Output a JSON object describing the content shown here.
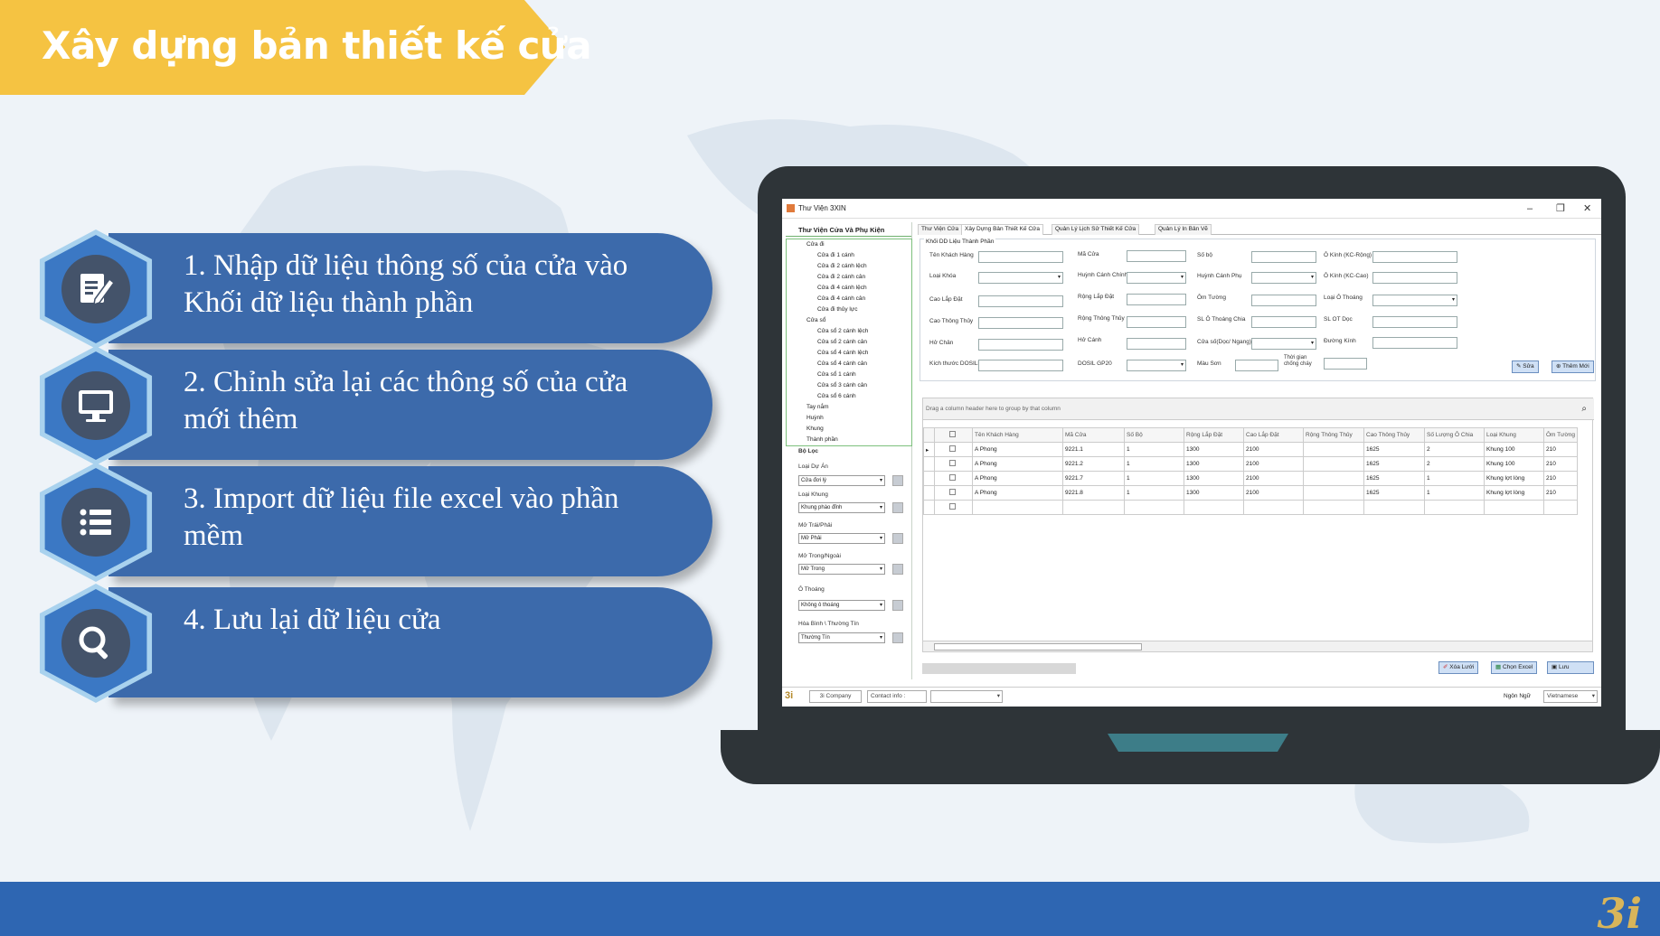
{
  "slide": {
    "title": "Xây dựng bản thiết kế cửa",
    "logo": "3i",
    "steps": [
      {
        "text": "1. Nhập dữ liệu thông số của cửa vào Khối dữ liệu thành phần",
        "icon": "edit-icon"
      },
      {
        "text": "2. Chỉnh sửa lại các thông số của cửa mới thêm",
        "icon": "monitor-icon"
      },
      {
        "text": "3. Import dữ liệu file excel vào phần mềm",
        "icon": "list-icon"
      },
      {
        "text": "4. Lưu lại dữ liệu cửa",
        "icon": "search-icon"
      }
    ]
  },
  "app": {
    "window_title": "Thư Viện 3XIN",
    "sidebar_title": "Thư Viện Cửa Và Phụ Kiện",
    "tree": [
      {
        "label": "Cửa đi",
        "level": 0
      },
      {
        "label": "Cửa đi 1 cánh",
        "level": 1
      },
      {
        "label": "Cửa đi 2 cánh lệch",
        "level": 1
      },
      {
        "label": "Cửa đi 2 cánh cân",
        "level": 1
      },
      {
        "label": "Cửa đi 4 cánh lệch",
        "level": 1
      },
      {
        "label": "Cửa đi 4 cánh cân",
        "level": 1
      },
      {
        "label": "Cửa đi thủy lực",
        "level": 1
      },
      {
        "label": "Cửa sổ",
        "level": 0
      },
      {
        "label": "Cửa sổ 2 cánh lệch",
        "level": 1
      },
      {
        "label": "Cửa sổ 2 cánh cân",
        "level": 1
      },
      {
        "label": "Cửa sổ 4 cánh lệch",
        "level": 1
      },
      {
        "label": "Cửa sổ 4 cánh cân",
        "level": 1
      },
      {
        "label": "Cửa sổ 1 cánh",
        "level": 1
      },
      {
        "label": "Cửa sổ 3 cánh cân",
        "level": 1
      },
      {
        "label": "Cửa sổ 6 cánh",
        "level": 1
      },
      {
        "label": "Tay nắm",
        "level": 0
      },
      {
        "label": "Huỳnh",
        "level": 0
      },
      {
        "label": "Khung",
        "level": 0
      },
      {
        "label": "Thành phần",
        "level": 0
      }
    ],
    "filter": {
      "title": "Bộ Lọc",
      "items": [
        {
          "label": "Loại Dự Án",
          "value": "Cửa đơi lý"
        },
        {
          "label": "Loại Khung",
          "value": "Khung phào đỉnh"
        },
        {
          "label": "Mở Trái/Phải",
          "value": "Mở Phải"
        },
        {
          "label": "Mở Trong/Ngoài",
          "value": "Mở Trong"
        },
        {
          "label": "Ô Thoáng",
          "value": "Không ô thoáng"
        },
        {
          "label": "Hòa Bình \\ Thường Tín",
          "value": "Thường Tín"
        }
      ]
    },
    "tabs": [
      "Thư Viện Cửa",
      "Xây Dựng Bản Thiết Kế Cửa",
      "Quản Lý Lịch Sử Thiết Kế Cửa",
      "Quản Lý In Bản Vẽ"
    ],
    "panel_title": "Khối DD Liệu Thành Phần",
    "fields": {
      "col1": [
        "Tên Khách Hàng",
        "Loại Khóa",
        "Cao Lắp Đặt",
        "Cao Thông Thủy",
        "Hở Chân",
        "Kích thước DOSILL"
      ],
      "col2": [
        "Mã Cửa",
        "Huỳnh Cánh Chính",
        "Rộng Lắp Đặt",
        "Rộng Thông Thủy",
        "Hở Cánh",
        "DOSIL GP20"
      ],
      "col3": [
        "Số bộ",
        "Huỳnh Cánh Phụ",
        "Ôm Tường",
        "SL Ô Thoáng Chia",
        "Cửa số(Dọc/ Ngang)",
        "Màu Sơn"
      ],
      "col4": [
        "Ô Kính (KC-Rộng)",
        "Ô Kính (KC-Cao)",
        "Loại Ô Thoáng",
        "SL OT Dọc",
        "Đường Kính"
      ],
      "fire_label": "Thời gian chống cháy"
    },
    "buttons": {
      "edit": "Sửa",
      "add": "Thêm Mới",
      "clear_grid": "Xóa Lưới",
      "choose_excel": "Chọn Excel",
      "save": "Lưu"
    },
    "grid": {
      "group_hint": "Drag a column header here to group by that column",
      "columns": [
        "",
        "",
        "Tên Khách Hàng",
        "Mã Cửa",
        "Số Bộ",
        "Rộng Lắp Đặt",
        "Cao Lắp Đặt",
        "Rộng Thông Thủy",
        "Cao Thông Thủy",
        "Số Lượng Ô Chia",
        "Loại Khung",
        "Ôm Tường"
      ],
      "rows": [
        [
          "▸",
          "",
          "A Phong",
          "9221.1",
          "1",
          "1300",
          "2100",
          "",
          "1625",
          "2",
          "Khung 100",
          "210"
        ],
        [
          "",
          "",
          "A Phong",
          "9221.2",
          "1",
          "1300",
          "2100",
          "",
          "1625",
          "2",
          "Khung 100",
          "210"
        ],
        [
          "",
          "",
          "A Phong",
          "9221.7",
          "1",
          "1300",
          "2100",
          "",
          "1625",
          "1",
          "Khung lợt lòng",
          "210"
        ],
        [
          "",
          "",
          "A Phong",
          "9221.8",
          "1",
          "1300",
          "2100",
          "",
          "1625",
          "1",
          "Khung lợt lòng",
          "210"
        ],
        [
          "",
          "",
          "",
          "",
          "",
          "",
          "",
          "",
          "",
          "",
          "",
          ""
        ]
      ]
    },
    "footer": {
      "company": "3i Company",
      "contact": "Contact info :",
      "language_label": "Ngôn Ngữ",
      "language_value": "Vietnamese",
      "logo": "3i"
    }
  }
}
